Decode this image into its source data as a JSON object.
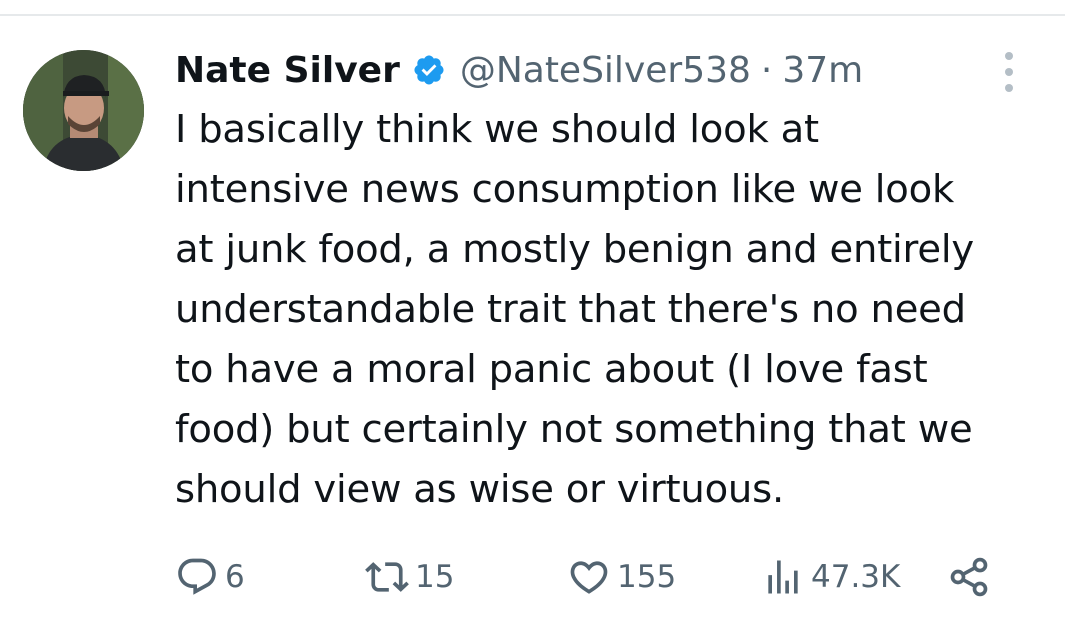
{
  "tweet": {
    "author_name": "Nate Silver",
    "handle": "@NateSilver538",
    "separator": "·",
    "time": "37m",
    "text_lines": [
      "I basically think we should look at",
      "intensive news consumption like we look",
      "at junk food, a mostly benign and entirely",
      "understandable trait that there's no need",
      "to have a moral panic about (I love fast",
      "food) but certainly not something that we",
      "should view as wise or virtuous."
    ]
  },
  "actions": {
    "replies": "6",
    "reposts": "15",
    "likes": "155",
    "views": "47.3K"
  },
  "icons": {
    "verified": "verified-badge-icon",
    "more": "more-vertical-icon",
    "reply": "reply-icon",
    "repost": "repost-icon",
    "like": "heart-icon",
    "views": "views-bar-chart-icon",
    "share": "share-icon"
  },
  "colors": {
    "text": "#0f1419",
    "secondary": "#536471",
    "verified": "#1d9bf0"
  }
}
